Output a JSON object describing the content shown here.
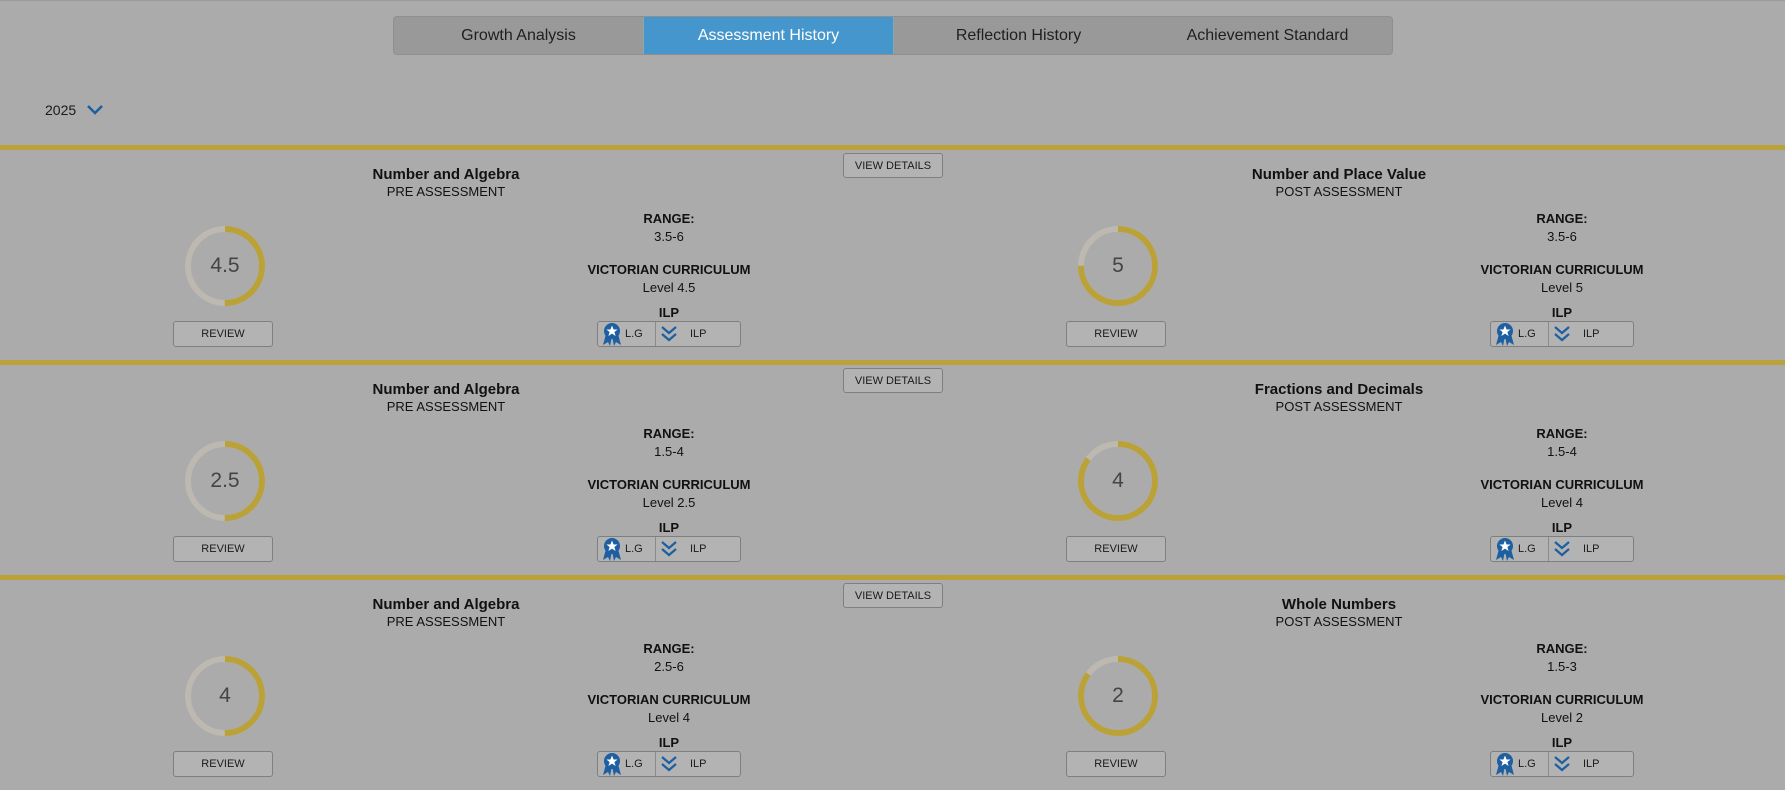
{
  "tabs": [
    {
      "label": "Growth Analysis",
      "active": false
    },
    {
      "label": "Assessment History",
      "active": true
    },
    {
      "label": "Reflection History",
      "active": false
    },
    {
      "label": "Achievement Standard",
      "active": false
    }
  ],
  "year": {
    "value": "2025"
  },
  "labels": {
    "view_details": "VIEW DETAILS",
    "review": "REVIEW",
    "range": "RANGE:",
    "curriculum": "VICTORIAN CURRICULUM",
    "ilp": "ILP",
    "lg_button": "L.G",
    "ilp_button": "ILP"
  },
  "colors": {
    "accent": "#bba238",
    "tab_active": "#4596cc",
    "icon_blue": "#1d5fa0",
    "gauge_track": "#bdb8b0"
  },
  "rows": [
    {
      "left": {
        "title": "Number and Algebra",
        "type": "PRE ASSESSMENT",
        "score": "4.5",
        "fraction": 0.5,
        "range": "3.5-6",
        "level": "Level 4.5"
      },
      "right": {
        "title": "Number and Place Value",
        "type": "POST ASSESSMENT",
        "score": "5",
        "fraction": 0.75,
        "range": "3.5-6",
        "level": "Level 5"
      }
    },
    {
      "left": {
        "title": "Number and Algebra",
        "type": "PRE ASSESSMENT",
        "score": "2.5",
        "fraction": 0.5,
        "range": "1.5-4",
        "level": "Level 2.5"
      },
      "right": {
        "title": "Fractions and Decimals",
        "type": "POST ASSESSMENT",
        "score": "4",
        "fraction": 0.85,
        "range": "1.5-4",
        "level": "Level 4"
      }
    },
    {
      "left": {
        "title": "Number and Algebra",
        "type": "PRE ASSESSMENT",
        "score": "4",
        "fraction": 0.5,
        "range": "2.5-6",
        "level": "Level 4"
      },
      "right": {
        "title": "Whole Numbers",
        "type": "POST ASSESSMENT",
        "score": "2",
        "fraction": 0.85,
        "range": "1.5-3",
        "level": "Level 2"
      }
    }
  ]
}
